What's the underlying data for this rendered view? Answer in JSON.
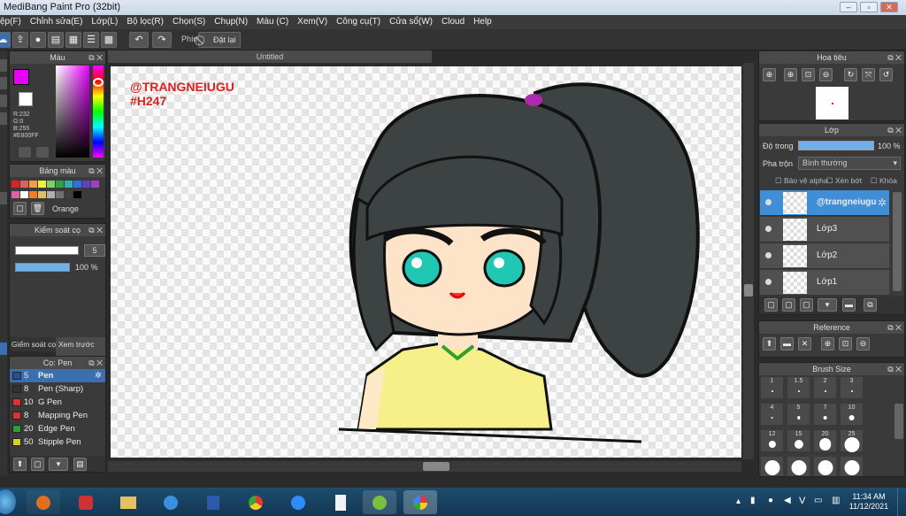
{
  "window": {
    "title": "MediBang Paint Pro (32bit)"
  },
  "menu": [
    "ệp(F)",
    "Chỉnh sửa(E)",
    "Lớp(L)",
    "Bộ lọc(R)",
    "Chọn(S)",
    "Chụp(N)",
    "Màu (C)",
    "Xem(V)",
    "Công cụ(T)",
    "Cửa sổ(W)",
    "Cloud",
    "Help"
  ],
  "toolbar": {
    "phim_label": "Phím",
    "undo_label": "Đặt lại"
  },
  "canvas": {
    "tab_title": "Untitled",
    "watermark_line1": "@TRANGNEIUGU",
    "watermark_line2": "#H247"
  },
  "color_panel": {
    "title": "Màu",
    "r": "R:232",
    "g": "G:0",
    "b": "B:255",
    "hex": "#E800FF",
    "primary": "#e800ff",
    "secondary": "#ffffff"
  },
  "palette_panel": {
    "title": "Bảng màu",
    "selected_name": "Orange",
    "colors": [
      "#e02020",
      "#e06060",
      "#f0a040",
      "#f0f040",
      "#80d060",
      "#30a040",
      "#30b0b0",
      "#3070e0",
      "#6040c0",
      "#a040c0",
      "#e060a0",
      "#ffffff",
      "#f08020",
      "#e0c060",
      "#b0b0b0",
      "#707070",
      "#404040",
      "#000000"
    ]
  },
  "brush_control": {
    "title": "Kiểm soát cọ",
    "size_value": "5",
    "opacity_value": "100 %",
    "tab1": "Giểm soát cọ",
    "tab2": "Xem trước cọ"
  },
  "brush_panel": {
    "title": "Cọ: Pen",
    "items": [
      {
        "num": "5",
        "name": "Pen",
        "color": "#2b4f8c",
        "selected": true
      },
      {
        "num": "8",
        "name": "Pen (Sharp)",
        "color": "#333333"
      },
      {
        "num": "10",
        "name": "G Pen",
        "color": "#e03030"
      },
      {
        "num": "8",
        "name": "Mapping Pen",
        "color": "#e03030"
      },
      {
        "num": "20",
        "name": "Edge Pen",
        "color": "#30a030"
      },
      {
        "num": "50",
        "name": "Stipple Pen",
        "color": "#e0d020"
      }
    ]
  },
  "navigator_panel": {
    "title": "Hoa tiêu"
  },
  "layer_panel": {
    "title": "Lớp",
    "opacity_label": "Độ trong",
    "opacity_value": "100 %",
    "blend_label": "Pha trộn",
    "blend_value": "Bình thường",
    "protect_alpha": "Bảo vệ alpha",
    "clipping": "Xén bớt",
    "lock": "Khóa",
    "layers": [
      {
        "name": "@trangneiugu",
        "selected": true
      },
      {
        "name": "Lớp3"
      },
      {
        "name": "Lớp2"
      },
      {
        "name": "Lớp1"
      }
    ]
  },
  "reference_panel": {
    "title": "Reference"
  },
  "brush_size_panel": {
    "title": "Brush Size",
    "sizes": [
      "1",
      "1.5",
      "2",
      "3",
      "4",
      "5",
      "7",
      "10",
      "12",
      "15",
      "20",
      "25",
      "",
      "",
      "",
      ""
    ]
  },
  "taskbar": {
    "time": "11:34 AM",
    "date": "11/12/2021",
    "lang": "V"
  }
}
